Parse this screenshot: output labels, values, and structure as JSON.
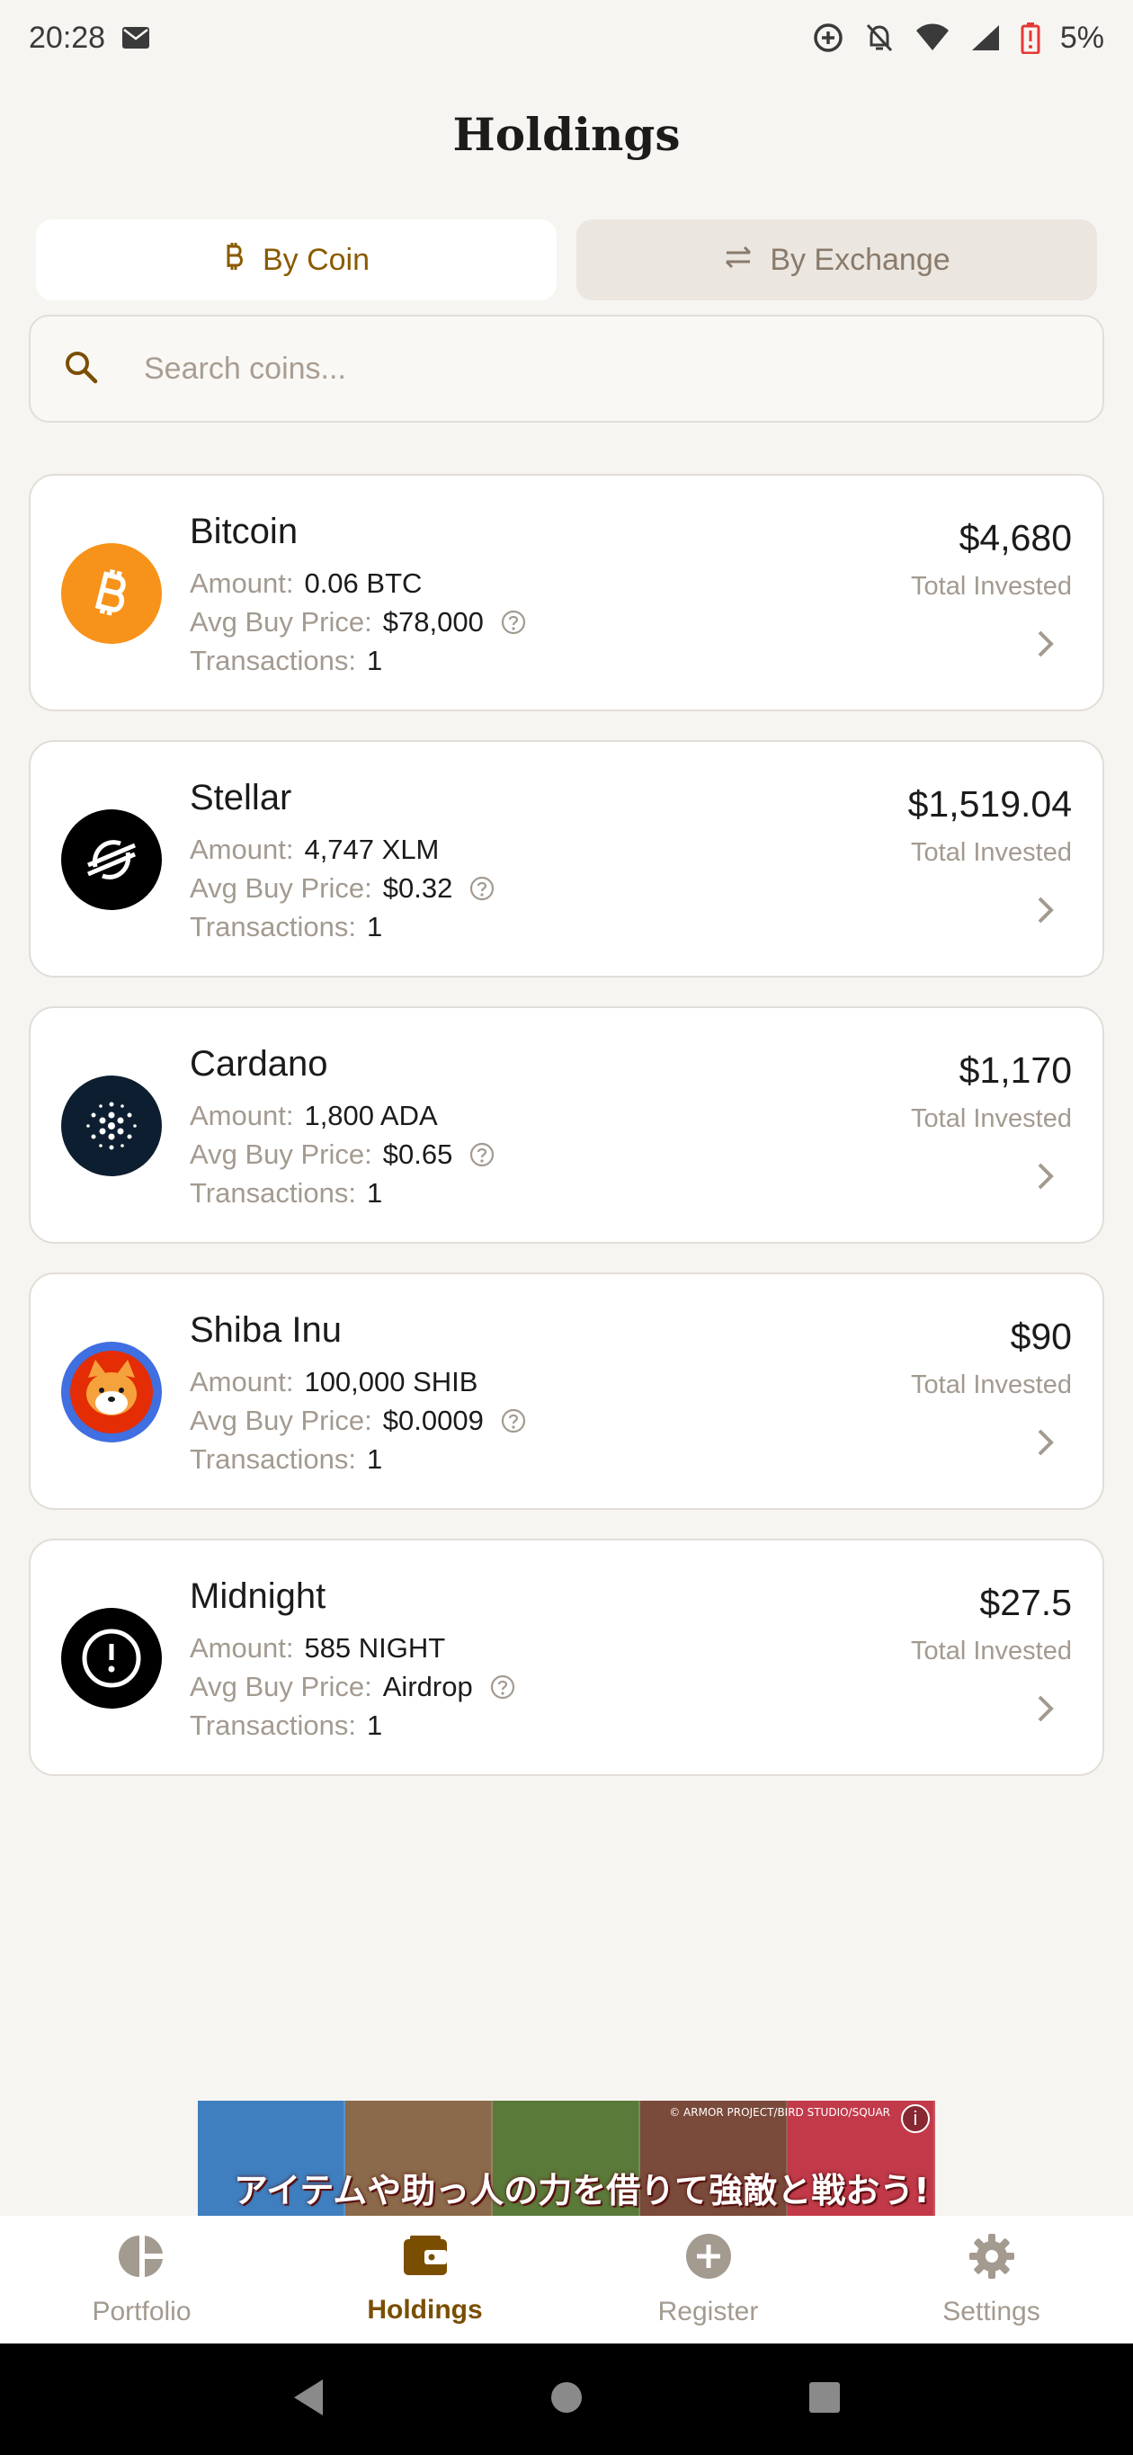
{
  "status_bar": {
    "time": "20:28",
    "battery": "5%"
  },
  "page": {
    "title": "Holdings"
  },
  "tabs": [
    {
      "label": "By Coin",
      "icon": "bitcoin-icon",
      "active": true
    },
    {
      "label": "By Exchange",
      "icon": "swap-icon",
      "active": false
    }
  ],
  "search": {
    "placeholder": "Search coins...",
    "value": ""
  },
  "labels": {
    "amount": "Amount:",
    "avg_buy_price": "Avg Buy Price:",
    "transactions": "Transactions:",
    "total_invested": "Total Invested"
  },
  "holdings": [
    {
      "name": "Bitcoin",
      "amount": "0.06 BTC",
      "avg_buy_price": "$78,000",
      "transactions": "1",
      "total_invested": "$4,680",
      "logo": "bitcoin-logo",
      "color": "#f7931a"
    },
    {
      "name": "Stellar",
      "amount": "4,747 XLM",
      "avg_buy_price": "$0.32",
      "transactions": "1",
      "total_invested": "$1,519.04",
      "logo": "stellar-logo",
      "color": "#000000"
    },
    {
      "name": "Cardano",
      "amount": "1,800 ADA",
      "avg_buy_price": "$0.65",
      "transactions": "1",
      "total_invested": "$1,170",
      "logo": "cardano-logo",
      "color": "#0d1e30"
    },
    {
      "name": "Shiba Inu",
      "amount": "100,000 SHIB",
      "avg_buy_price": "$0.0009",
      "transactions": "1",
      "total_invested": "$90",
      "logo": "shiba-inu-logo",
      "color": "#e42d04"
    },
    {
      "name": "Midnight",
      "amount": "585 NIGHT",
      "avg_buy_price": "Airdrop",
      "transactions": "1",
      "total_invested": "$27.5",
      "logo": "midnight-logo",
      "color": "#000000"
    }
  ],
  "ad": {
    "text": "アイテムや助っ人の力を借りて強敵と戦おう!",
    "copyright": "© ARMOR PROJECT/BIRD STUDIO/SQUAR"
  },
  "bottom_nav": [
    {
      "label": "Portfolio",
      "icon": "pie-chart-icon",
      "active": false
    },
    {
      "label": "Holdings",
      "icon": "wallet-icon",
      "active": true
    },
    {
      "label": "Register",
      "icon": "add-circle-icon",
      "active": false
    },
    {
      "label": "Settings",
      "icon": "gear-icon",
      "active": false
    }
  ],
  "colors": {
    "accent": "#8a5a00",
    "background": "#f7f5f2",
    "card": "#ffffff",
    "muted": "#a39a90"
  }
}
